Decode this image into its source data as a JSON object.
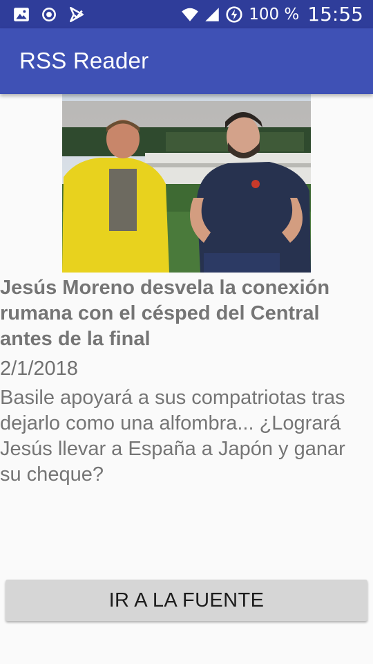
{
  "status_bar": {
    "battery_percent": "100 %",
    "time": "15:55",
    "icons": [
      "image-icon",
      "record-icon",
      "check-flag-icon",
      "wifi-icon",
      "signal-icon",
      "battery-charging-icon"
    ]
  },
  "app_bar": {
    "title": "RSS Reader",
    "color": "#3f51b5"
  },
  "article": {
    "image": "photo-two-men-talking-on-pitch",
    "title": "Jesús Moreno desvela la conexión rumana con el césped del Central antes de la final",
    "date": "2/1/2018",
    "description": "Basile apoyará a sus compatriotas tras dejarlo como una alfombra... ¿Logrará Jesús llevar a España a Japón y ganar su cheque?"
  },
  "actions": {
    "source_button_label": "IR A LA FUENTE"
  }
}
